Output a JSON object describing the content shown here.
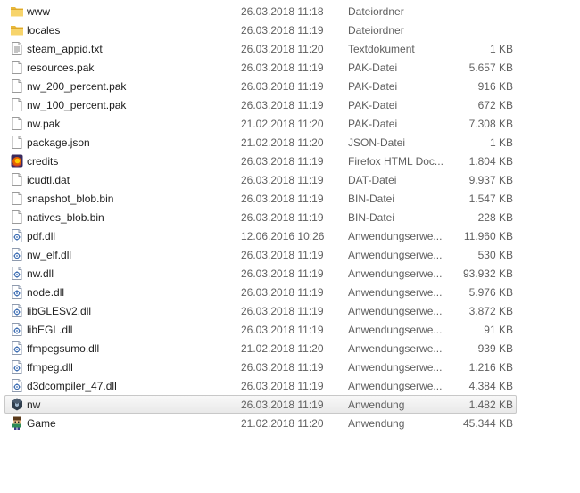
{
  "files": [
    {
      "name": "www",
      "date": "26.03.2018 11:18",
      "type": "Dateiordner",
      "size": "",
      "icon": "folder-icon"
    },
    {
      "name": "locales",
      "date": "26.03.2018 11:19",
      "type": "Dateiordner",
      "size": "",
      "icon": "folder-icon"
    },
    {
      "name": "steam_appid.txt",
      "date": "26.03.2018 11:20",
      "type": "Textdokument",
      "size": "1 KB",
      "icon": "text-document-icon"
    },
    {
      "name": "resources.pak",
      "date": "26.03.2018 11:19",
      "type": "PAK-Datei",
      "size": "5.657 KB",
      "icon": "file-icon"
    },
    {
      "name": "nw_200_percent.pak",
      "date": "26.03.2018 11:19",
      "type": "PAK-Datei",
      "size": "916 KB",
      "icon": "file-icon"
    },
    {
      "name": "nw_100_percent.pak",
      "date": "26.03.2018 11:19",
      "type": "PAK-Datei",
      "size": "672 KB",
      "icon": "file-icon"
    },
    {
      "name": "nw.pak",
      "date": "21.02.2018 11:20",
      "type": "PAK-Datei",
      "size": "7.308 KB",
      "icon": "file-icon"
    },
    {
      "name": "package.json",
      "date": "21.02.2018 11:20",
      "type": "JSON-Datei",
      "size": "1 KB",
      "icon": "file-icon"
    },
    {
      "name": "credits",
      "date": "26.03.2018 11:19",
      "type": "Firefox HTML Doc...",
      "size": "1.804 KB",
      "icon": "firefox-html-icon"
    },
    {
      "name": "icudtl.dat",
      "date": "26.03.2018 11:19",
      "type": "DAT-Datei",
      "size": "9.937 KB",
      "icon": "file-icon"
    },
    {
      "name": "snapshot_blob.bin",
      "date": "26.03.2018 11:19",
      "type": "BIN-Datei",
      "size": "1.547 KB",
      "icon": "file-icon"
    },
    {
      "name": "natives_blob.bin",
      "date": "26.03.2018 11:19",
      "type": "BIN-Datei",
      "size": "228 KB",
      "icon": "file-icon"
    },
    {
      "name": "pdf.dll",
      "date": "12.06.2016 10:26",
      "type": "Anwendungserwe...",
      "size": "11.960 KB",
      "icon": "dll-icon"
    },
    {
      "name": "nw_elf.dll",
      "date": "26.03.2018 11:19",
      "type": "Anwendungserwe...",
      "size": "530 KB",
      "icon": "dll-icon"
    },
    {
      "name": "nw.dll",
      "date": "26.03.2018 11:19",
      "type": "Anwendungserwe...",
      "size": "93.932 KB",
      "icon": "dll-icon"
    },
    {
      "name": "node.dll",
      "date": "26.03.2018 11:19",
      "type": "Anwendungserwe...",
      "size": "5.976 KB",
      "icon": "dll-icon"
    },
    {
      "name": "libGLESv2.dll",
      "date": "26.03.2018 11:19",
      "type": "Anwendungserwe...",
      "size": "3.872 KB",
      "icon": "dll-icon"
    },
    {
      "name": "libEGL.dll",
      "date": "26.03.2018 11:19",
      "type": "Anwendungserwe...",
      "size": "91 KB",
      "icon": "dll-icon"
    },
    {
      "name": "ffmpegsumo.dll",
      "date": "21.02.2018 11:20",
      "type": "Anwendungserwe...",
      "size": "939 KB",
      "icon": "dll-icon"
    },
    {
      "name": "ffmpeg.dll",
      "date": "26.03.2018 11:19",
      "type": "Anwendungserwe...",
      "size": "1.216 KB",
      "icon": "dll-icon"
    },
    {
      "name": "d3dcompiler_47.dll",
      "date": "26.03.2018 11:19",
      "type": "Anwendungserwe...",
      "size": "4.384 KB",
      "icon": "dll-icon"
    },
    {
      "name": "nw",
      "date": "26.03.2018 11:19",
      "type": "Anwendung",
      "size": "1.482 KB",
      "icon": "nwjs-app-icon",
      "selected": true
    },
    {
      "name": "Game",
      "date": "21.02.2018 11:20",
      "type": "Anwendung",
      "size": "45.344 KB",
      "icon": "game-app-icon"
    }
  ]
}
